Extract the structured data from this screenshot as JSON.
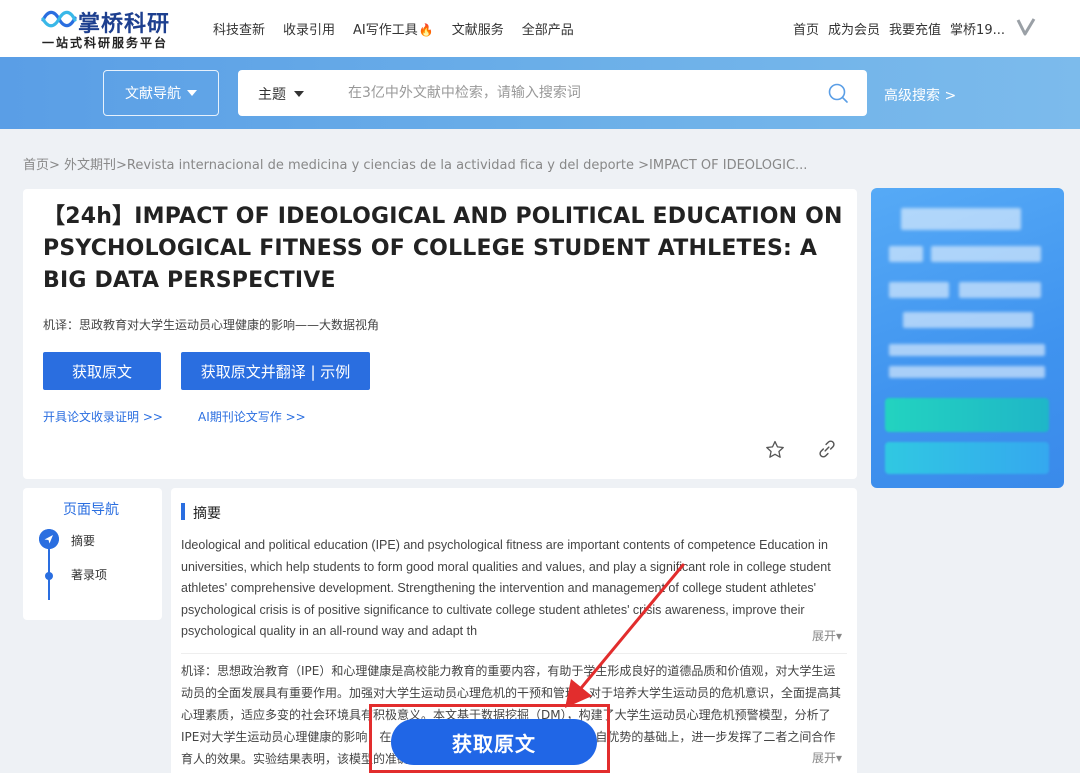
{
  "brand": {
    "name": "掌桥科研",
    "slogan": "一站式科研服务平台"
  },
  "nav": {
    "items": [
      "科技查新",
      "收录引用",
      "AI写作工具",
      "文献服务",
      "全部产品"
    ],
    "fire_icon": "fire-icon"
  },
  "user_nav": {
    "home": "首页",
    "member": "成为会员",
    "recharge": "我要充值",
    "account": "掌桥19..."
  },
  "search": {
    "docnav_label": "文献导航",
    "field_label": "主题",
    "placeholder": "在3亿中外文献中检索，请输入搜索词",
    "value": "",
    "advanced_label": "高级搜索 >"
  },
  "breadcrumb": "首页> 外文期刊>Revista internacional de medicina y ciencias de la actividad fica y del deporte >IMPACT OF IDEOLOGIC...",
  "paper": {
    "title": "【24h】IMPACT OF IDEOLOGICAL AND POLITICAL EDUCATION ON PSYCHOLOGICAL FITNESS OF COLLEGE STUDENT ATHLETES: A BIG DATA PERSPECTIVE",
    "machine_translation": "机译：思政教育对大学生运动员心理健康的影响——大数据视角",
    "btn_get_fulltext": "获取原文",
    "btn_get_translate": "获取原文并翻译 | 示例",
    "link_certificate": "开具论文收录证明 >>",
    "link_ai_writing": "AI期刊论文写作 >>"
  },
  "page_nav": {
    "title": "页面导航",
    "items": [
      "摘要",
      "著录项"
    ]
  },
  "abstract": {
    "heading": "摘要",
    "en": "Ideological and political education (IPE) and psychological fitness are important contents of competence Education in universities, which help students to form good moral qualities and values, and play a significant role in college student athletes' comprehensive development. Strengthening the intervention and management of college student athletes' psychological crisis is of positive significance to cultivate college student athletes' crisis awareness, improve their psychological quality in an all-round way and adapt th",
    "expand": "展开▾",
    "cn": "机译：思想政治教育（IPE）和心理健康是高校能力教育的重要内容，有助于学生形成良好的道德品质和价值观，对大学生运动员的全面发展具有重要作用。加强对大学生运动员心理危机的干预和管理，对于培养大学生运动员的危机意识，全面提高其心理素质，适应多变的社会环境具有积极意义。本文基于数据挖掘（DM），构建了大学生运动员心理危机预警模型，分析了IPE对大学生运动员心理健康的影响，在发挥思政教育与大学生心理健康教育各自优势的基础上，进一步发挥了二者之间合作育人的效果。实验结果表明，该模型的准确率明显优于对比算法，准确率",
    "expand2": "展开▾"
  },
  "overlay": {
    "cta": "获取原文"
  },
  "colors": {
    "primary": "#2a6ee0",
    "band": "#5a9ee6",
    "annotation_red": "#e22d2d"
  }
}
